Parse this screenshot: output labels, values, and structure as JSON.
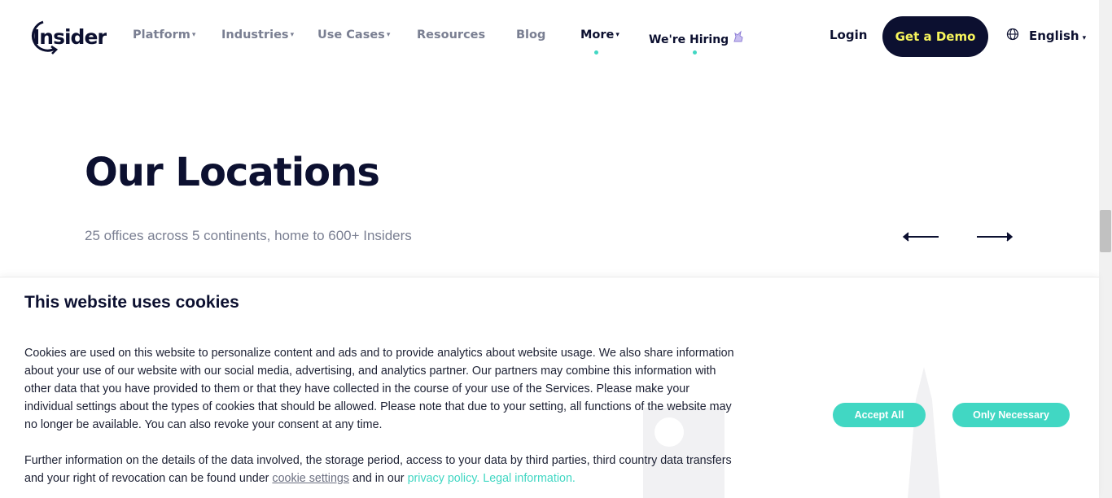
{
  "header": {
    "logo_text": "Insider",
    "nav": [
      {
        "label": "Platform",
        "caret": "▾"
      },
      {
        "label": "Industries",
        "caret": "▾"
      },
      {
        "label": "Use Cases",
        "caret": "▾"
      },
      {
        "label": "Resources"
      },
      {
        "label": "Blog"
      },
      {
        "label": "More",
        "caret": "▾"
      },
      {
        "label": "We're Hiring"
      }
    ],
    "login_label": "Login",
    "demo_label": "Get a Demo",
    "language_label": "English",
    "language_caret": "▾"
  },
  "main": {
    "title": "Our Locations",
    "subtitle": "25 offices across 5 continents, home to 600+ Insiders"
  },
  "cookie": {
    "title": "This website uses cookies",
    "paragraph1": "Cookies are used on this website to personalize content and ads and to provide analytics about website usage. We also share information about your use of our website with our social media, advertising, and analytics partner. Our partners may combine this information with other data that you have provided to them or that they have collected in the course of your use of the Services. Please make your individual settings about the types of cookies that should be allowed. Please note that due to your setting, all functions of the website may no longer be available. You can also revoke your consent at any time.",
    "paragraph2_prefix": "Further information on the details of the data involved, the storage period, access to your data by third parties, third country data transfers and your right of revocation can be found under",
    "cookie_settings_link": "cookie settings",
    "paragraph2_mid": "and in our",
    "privacy_link": "privacy policy. Legal information.",
    "accept_all_label": "Accept All",
    "only_necessary_label": "Only Necessary"
  },
  "colors": {
    "navy": "#0c1030",
    "teal": "#41d7c3",
    "yellow": "#f7f55c",
    "grey_text": "#7a7f92"
  },
  "icons": {
    "hiring": "unicorn-icon",
    "language": "globe-icon",
    "prev": "arrow-left-icon",
    "next": "arrow-right-icon"
  }
}
